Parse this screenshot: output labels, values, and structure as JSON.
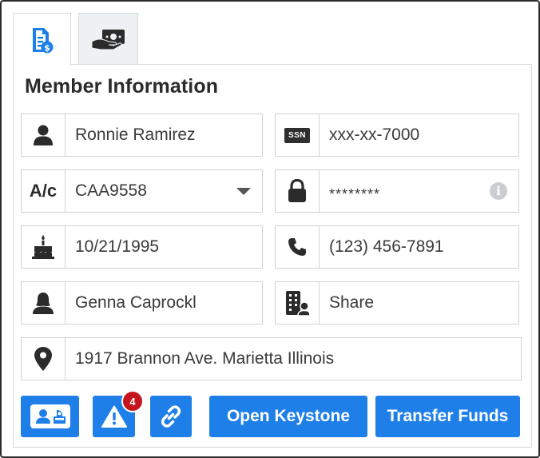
{
  "tabs": [
    {
      "icon": "document-dollar-icon",
      "active": true
    },
    {
      "icon": "hand-cash-icon",
      "active": false
    }
  ],
  "section": {
    "title": "Member Information"
  },
  "fields": {
    "name": {
      "icon": "user-icon",
      "value": "Ronnie Ramirez"
    },
    "ssn": {
      "icon": "ssn-icon",
      "icon_text": "SSN",
      "value": "xxx-xx-7000"
    },
    "account": {
      "icon": "account-icon",
      "icon_text": "A/c",
      "value": "CAA9558"
    },
    "password": {
      "icon": "lock-icon",
      "value": "********",
      "info_icon": "info-icon",
      "info_text": "i"
    },
    "birthdate": {
      "icon": "birthday-cake-icon",
      "value": "10/21/1995"
    },
    "phone": {
      "icon": "phone-icon",
      "value": "(123) 456-7891"
    },
    "joint_owner": {
      "icon": "female-user-icon",
      "value": "Genna Caprockl"
    },
    "account_type": {
      "icon": "building-user-icon",
      "value": "Share"
    },
    "address": {
      "icon": "map-marker-icon",
      "value": "1917 Brannon Ave. Marietta Illinois"
    }
  },
  "actions": {
    "id_card": {
      "icon": "id-card-icon"
    },
    "alerts": {
      "icon": "warning-icon",
      "badge_count": "4"
    },
    "link": {
      "icon": "link-icon"
    },
    "open_keystone": {
      "label": "Open Keystone"
    },
    "transfer_funds": {
      "label": "Transfer Funds"
    }
  },
  "colors": {
    "primary": "#1e7fe8",
    "badge": "#c4171d",
    "border": "#cfd4d8",
    "tab_inactive": "#eef1f3"
  }
}
